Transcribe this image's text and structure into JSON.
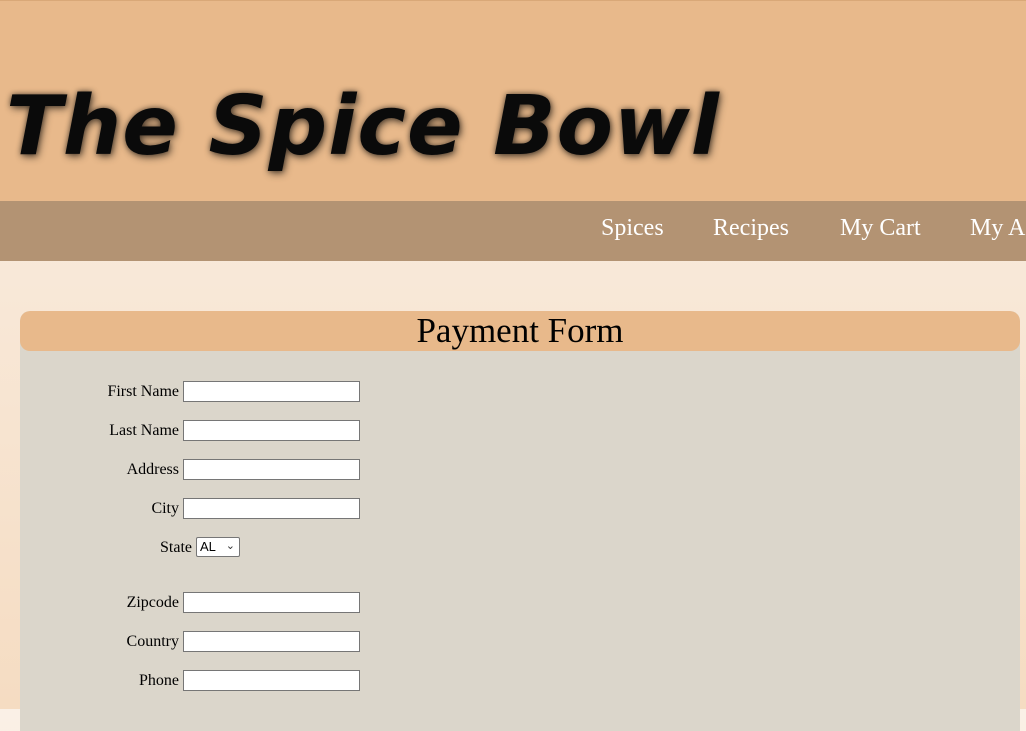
{
  "site": {
    "title": "The Spice Bowl"
  },
  "nav": {
    "items": [
      {
        "label": "Spices"
      },
      {
        "label": "Recipes"
      },
      {
        "label": "My Cart"
      },
      {
        "label": "My A"
      }
    ]
  },
  "form": {
    "title": "Payment Form",
    "fields": {
      "first_name": {
        "label": "First Name",
        "value": ""
      },
      "last_name": {
        "label": "Last Name",
        "value": ""
      },
      "address": {
        "label": "Address",
        "value": ""
      },
      "city": {
        "label": "City",
        "value": ""
      },
      "state": {
        "label": "State",
        "selected": "AL"
      },
      "zipcode": {
        "label": "Zipcode",
        "value": ""
      },
      "country": {
        "label": "Country",
        "value": ""
      },
      "phone": {
        "label": "Phone",
        "value": ""
      }
    }
  },
  "icons": {
    "state_dropdown": "chevron-down-icon"
  },
  "colors": {
    "banner": "#e8b98b",
    "nav": "#b39373",
    "panel": "#dbd6cb",
    "header": "#e8b98b"
  }
}
